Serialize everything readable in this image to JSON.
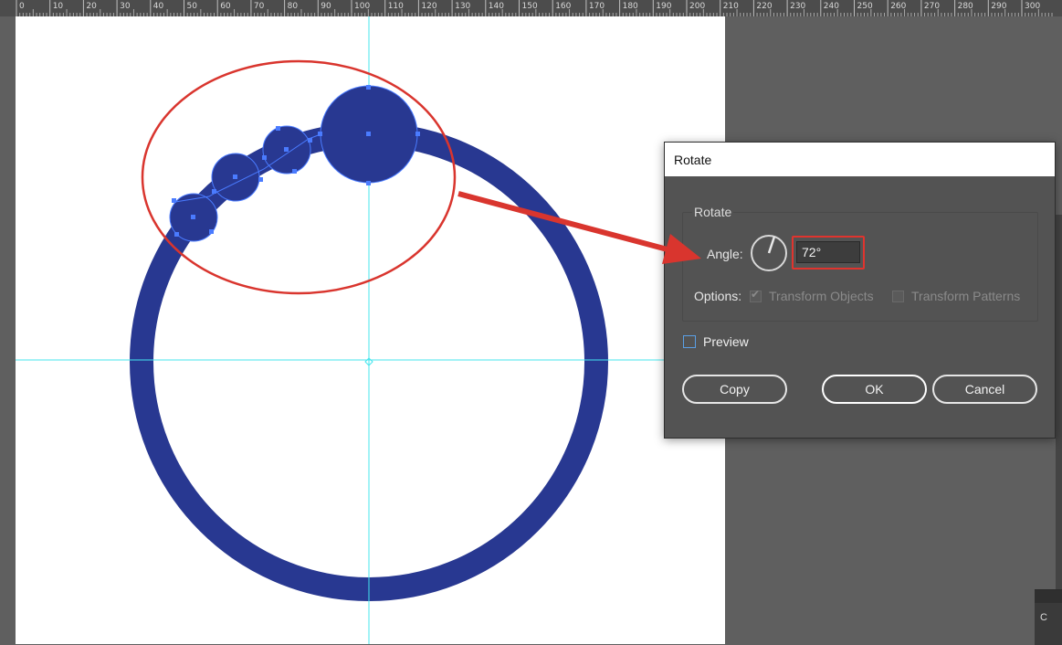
{
  "ruler": {
    "labels": [
      "0",
      "10",
      "20",
      "30",
      "40",
      "50",
      "60",
      "70",
      "80",
      "90",
      "100",
      "110",
      "120",
      "130",
      "140",
      "150",
      "160",
      "170",
      "180",
      "190",
      "200",
      "210",
      "220",
      "230",
      "240",
      "250",
      "260",
      "270",
      "280",
      "290",
      "300"
    ]
  },
  "colors": {
    "artwork_fill": "#283891",
    "guide": "#45e6ee",
    "annotation_red": "#d9352e",
    "selection": "#4a7bff"
  },
  "dialog": {
    "title": "Rotate",
    "group_label": "Rotate",
    "angle_label": "Angle:",
    "angle_value": "72°",
    "options_label": "Options:",
    "transform_objects_label": "Transform Objects",
    "transform_objects_checked": true,
    "transform_patterns_label": "Transform Patterns",
    "transform_patterns_checked": false,
    "preview_label": "Preview",
    "preview_checked": false,
    "copy_label": "Copy",
    "ok_label": "OK",
    "cancel_label": "Cancel"
  },
  "panel_stub": {
    "label": "C"
  },
  "icons": {
    "angle_dial": "angle-dial-icon",
    "checkmark": "checkmark-icon"
  }
}
